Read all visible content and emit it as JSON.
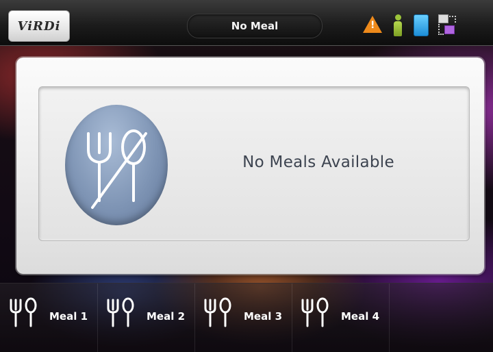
{
  "header": {
    "logo_text": "ViRDi",
    "status_text": "No Meal",
    "status_icons": [
      "warning-icon",
      "person-icon",
      "door-icon",
      "network-icon"
    ]
  },
  "main": {
    "message": "No Meals Available",
    "icon": "fork-spoon-crossed-icon"
  },
  "meals": [
    {
      "label": "Meal 1",
      "icon": "fork-spoon-icon"
    },
    {
      "label": "Meal 2",
      "icon": "fork-spoon-icon"
    },
    {
      "label": "Meal 3",
      "icon": "fork-spoon-icon"
    },
    {
      "label": "Meal 4",
      "icon": "fork-spoon-icon"
    }
  ],
  "colors": {
    "warning": "#ee8a1b",
    "person": "#9cc43a",
    "door": "#1d8ed8",
    "network": "#b066e0"
  }
}
